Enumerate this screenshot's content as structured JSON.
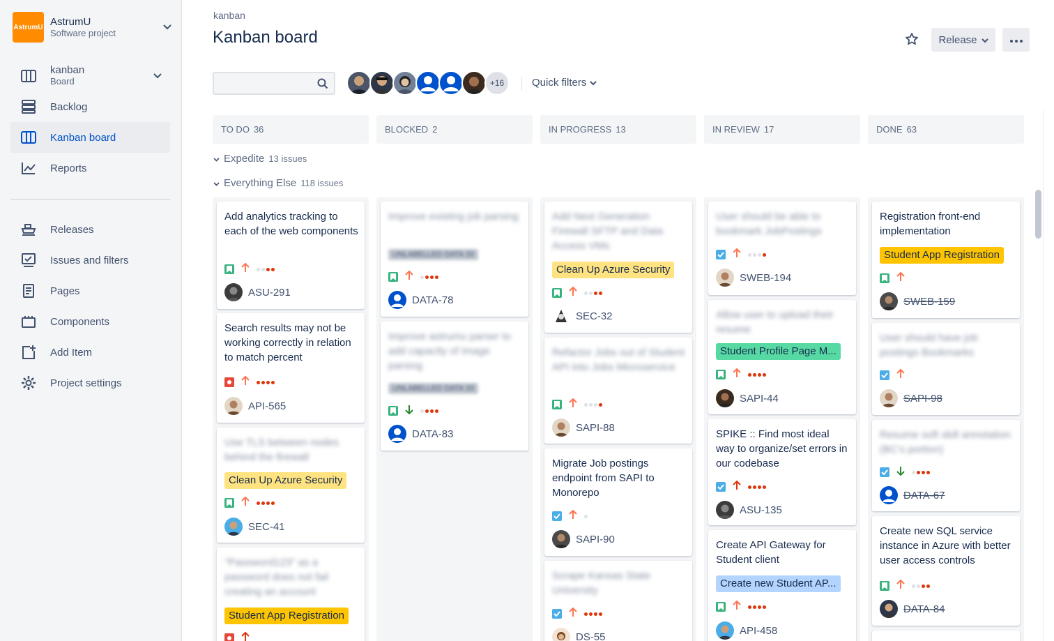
{
  "project": {
    "logo_text": "AstrumU",
    "name": "AstrumU",
    "type": "Software project"
  },
  "sidebar": {
    "board_switcher": {
      "name": "kanban",
      "sub": "Board"
    },
    "items": [
      {
        "label": "Backlog",
        "icon": "backlog-icon"
      },
      {
        "label": "Kanban board",
        "icon": "board-icon",
        "active": true
      },
      {
        "label": "Reports",
        "icon": "reports-icon"
      },
      {
        "label": "Releases",
        "icon": "ship-icon"
      },
      {
        "label": "Issues and filters",
        "icon": "issues-icon"
      },
      {
        "label": "Pages",
        "icon": "page-icon"
      },
      {
        "label": "Components",
        "icon": "components-icon"
      },
      {
        "label": "Add Item",
        "icon": "add-item-icon"
      },
      {
        "label": "Project settings",
        "icon": "gear-icon"
      }
    ]
  },
  "header": {
    "breadcrumb": "kanban",
    "title": "Kanban board",
    "release_label": "Release"
  },
  "filters": {
    "search_placeholder": "",
    "more_avatars": "+16",
    "quick_filters": "Quick filters"
  },
  "columns": [
    {
      "name": "TO DO",
      "count": "36"
    },
    {
      "name": "BLOCKED",
      "count": "2"
    },
    {
      "name": "IN PROGRESS",
      "count": "13"
    },
    {
      "name": "IN REVIEW",
      "count": "17"
    },
    {
      "name": "DONE",
      "count": "63"
    }
  ],
  "swimlanes": [
    {
      "name": "Expedite",
      "count": "13 issues"
    },
    {
      "name": "Everything Else",
      "count": "118 issues"
    }
  ],
  "cards": {
    "c0": [
      {
        "title": "Add analytics tracking to each of the web components",
        "key": "ASU-291"
      },
      {
        "title": "Search results may not be working correctly in relation to match percent",
        "key": "API-565"
      },
      {
        "title": "Use TLS between nodes behind the firewall",
        "epic": "Clean Up Azure Security",
        "key": "SEC-41"
      },
      {
        "title": "\"Password123\" as a password does not fail creating an account",
        "epic": "Student App Registration",
        "key": ""
      }
    ],
    "c1": [
      {
        "title": "Improve existing job parsing",
        "epic": "UNLABELLED DATA 33",
        "key": "DATA-78"
      },
      {
        "title": "Improve astrumu parser to add capacity of image parsing",
        "epic": "UNLABELLED DATA 33",
        "key": "DATA-83"
      }
    ],
    "c2": [
      {
        "title": "Add Next Generation Firewall SFTP and Data Access VMs",
        "epic": "Clean Up Azure Security",
        "key": "SEC-32"
      },
      {
        "title": "Refactor Jobs out of Student API into Jobs Microservice",
        "key": "SAPI-88"
      },
      {
        "title": "Migrate Job postings endpoint from SAPI to Monorepo",
        "key": "SAPI-90"
      },
      {
        "title": "Scrape Kansas State University",
        "key": "DS-55"
      }
    ],
    "c3": [
      {
        "title": "User should be able to bookmark JobPostings",
        "key": "SWEB-194"
      },
      {
        "title": "Allow user to upload their resume",
        "epic": "Student Profile Page M...",
        "key": "SAPI-44"
      },
      {
        "title": "SPIKE :: Find most ideal way to organize/set errors in our codebase",
        "key": "ASU-135"
      },
      {
        "title": "Create API Gateway for Student client",
        "epic": "Create new Student AP...",
        "key": "API-458"
      }
    ],
    "c4": [
      {
        "title": "Registration front-end implementation",
        "epic": "Student App Registration",
        "key": "SWEB-159"
      },
      {
        "title": "User should have job postings Bookmarks",
        "key": "SAPI-98"
      },
      {
        "title": "Resume soft skill annotation (BC's portion)",
        "key": "DATA-67"
      },
      {
        "title": "Create new SQL service instance in Azure with better user access controls",
        "key": "DATA-84"
      }
    ]
  },
  "colors": {
    "accent": "#0052cc",
    "story": "#36b37e",
    "bug": "#e5493a",
    "task": "#4bade8",
    "epic_yellow": "#ffc400",
    "epic_green": "#57d9a3",
    "epic_blue": "#b3d4ff",
    "epic_orange": "#ffab00"
  }
}
